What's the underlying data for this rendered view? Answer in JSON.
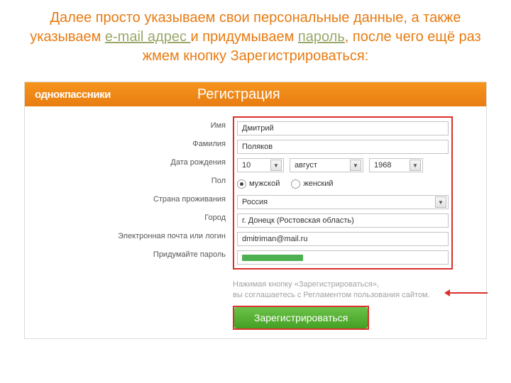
{
  "caption": {
    "part1": "Далее просто указываем свои персональные данные",
    "comma1": ",",
    "part2": " а также указываем ",
    "link1": "e-mail адрес ",
    "part3": "и придумываем ",
    "link2": "пароль",
    "comma2": ",",
    "part4": " после чего ещё раз жмем кнопку Зарегистрироваться",
    "colon": ":"
  },
  "header": {
    "logo": "однокпассники",
    "title": "Регистрация"
  },
  "labels": {
    "first_name": "Имя",
    "last_name": "Фамилия",
    "birth_date": "Дата рождения",
    "gender": "Пол",
    "country": "Страна проживания",
    "city": "Город",
    "email": "Электронная почта или логин",
    "password": "Придумайте пароль"
  },
  "values": {
    "first_name": "Дмитрий",
    "last_name": "Поляков",
    "birth_day": "10",
    "birth_month": "август",
    "birth_year": "1968",
    "gender_male": "мужской",
    "gender_female": "женский",
    "gender_selected": "male",
    "country": "Россия",
    "city": "г. Донецк (Ростовская область)",
    "email": "dmitriman@mail.ru"
  },
  "disclaimer": {
    "line1": "Нажимая кнопку «Зарегистрироваться»,",
    "line2": "вы соглашаетесь с Регламентом пользования сайтом."
  },
  "button": {
    "register": "Зарегистрироваться"
  }
}
